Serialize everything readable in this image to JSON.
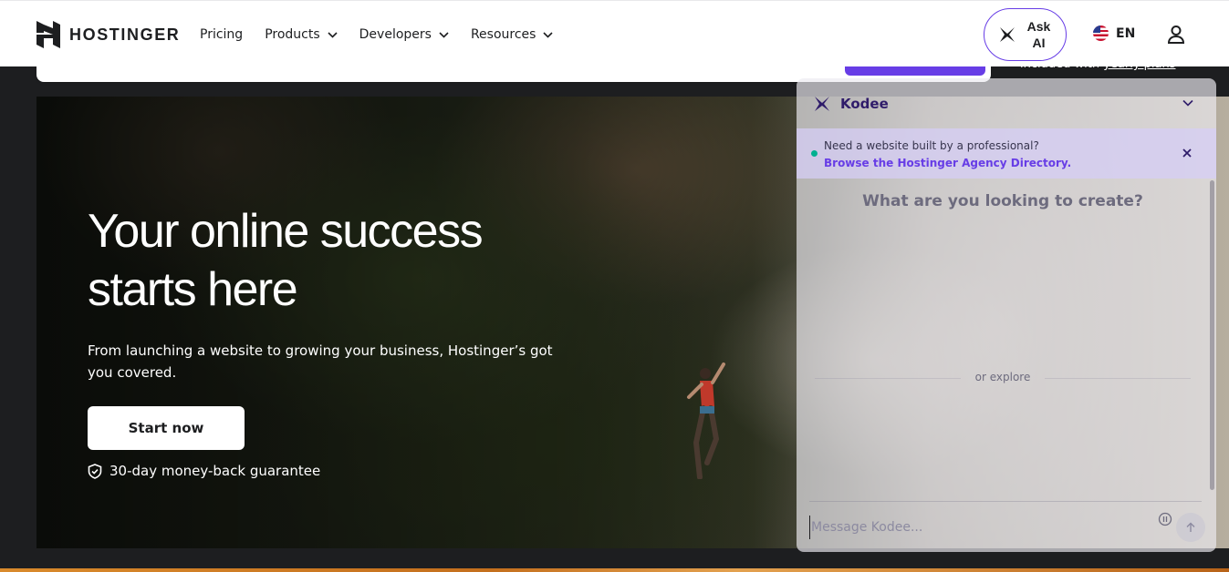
{
  "header": {
    "logo_text": "HOSTINGER",
    "nav": [
      {
        "label": "Pricing",
        "has_dropdown": false
      },
      {
        "label": "Products",
        "has_dropdown": true
      },
      {
        "label": "Developers",
        "has_dropdown": true
      },
      {
        "label": "Resources",
        "has_dropdown": true
      }
    ],
    "ask_ai_line1": "Ask",
    "ask_ai_line2": "AI",
    "language": "EN"
  },
  "promo": {
    "note_prefix": "included with ",
    "note_link": "yearly plans"
  },
  "hero": {
    "title_line1": "Your online success",
    "title_line2": "starts here",
    "subtitle": "From launching a website to growing your business, Hostinger’s got you covered.",
    "cta_label": "Start now",
    "guarantee": "30-day money-back guarantee"
  },
  "kodee": {
    "title": "Kodee",
    "banner_question": "Need a website built by a professional?",
    "banner_link": "Browse the Hostinger Agency Directory.",
    "prompt": "What are you looking to create?",
    "explore_label": "or explore",
    "input_placeholder": "Message Kodee..."
  },
  "colors": {
    "brand_purple": "#673de6",
    "header_bg": "#ffffff",
    "page_dark": "#1d1e20",
    "status_green": "#00b090"
  },
  "icons": [
    "hostinger-logo-icon",
    "chevron-down-icon",
    "kodee-logo-icon",
    "us-flag-icon",
    "user-icon",
    "shield-check-icon",
    "close-icon",
    "info-icon",
    "send-arrow-icon"
  ]
}
